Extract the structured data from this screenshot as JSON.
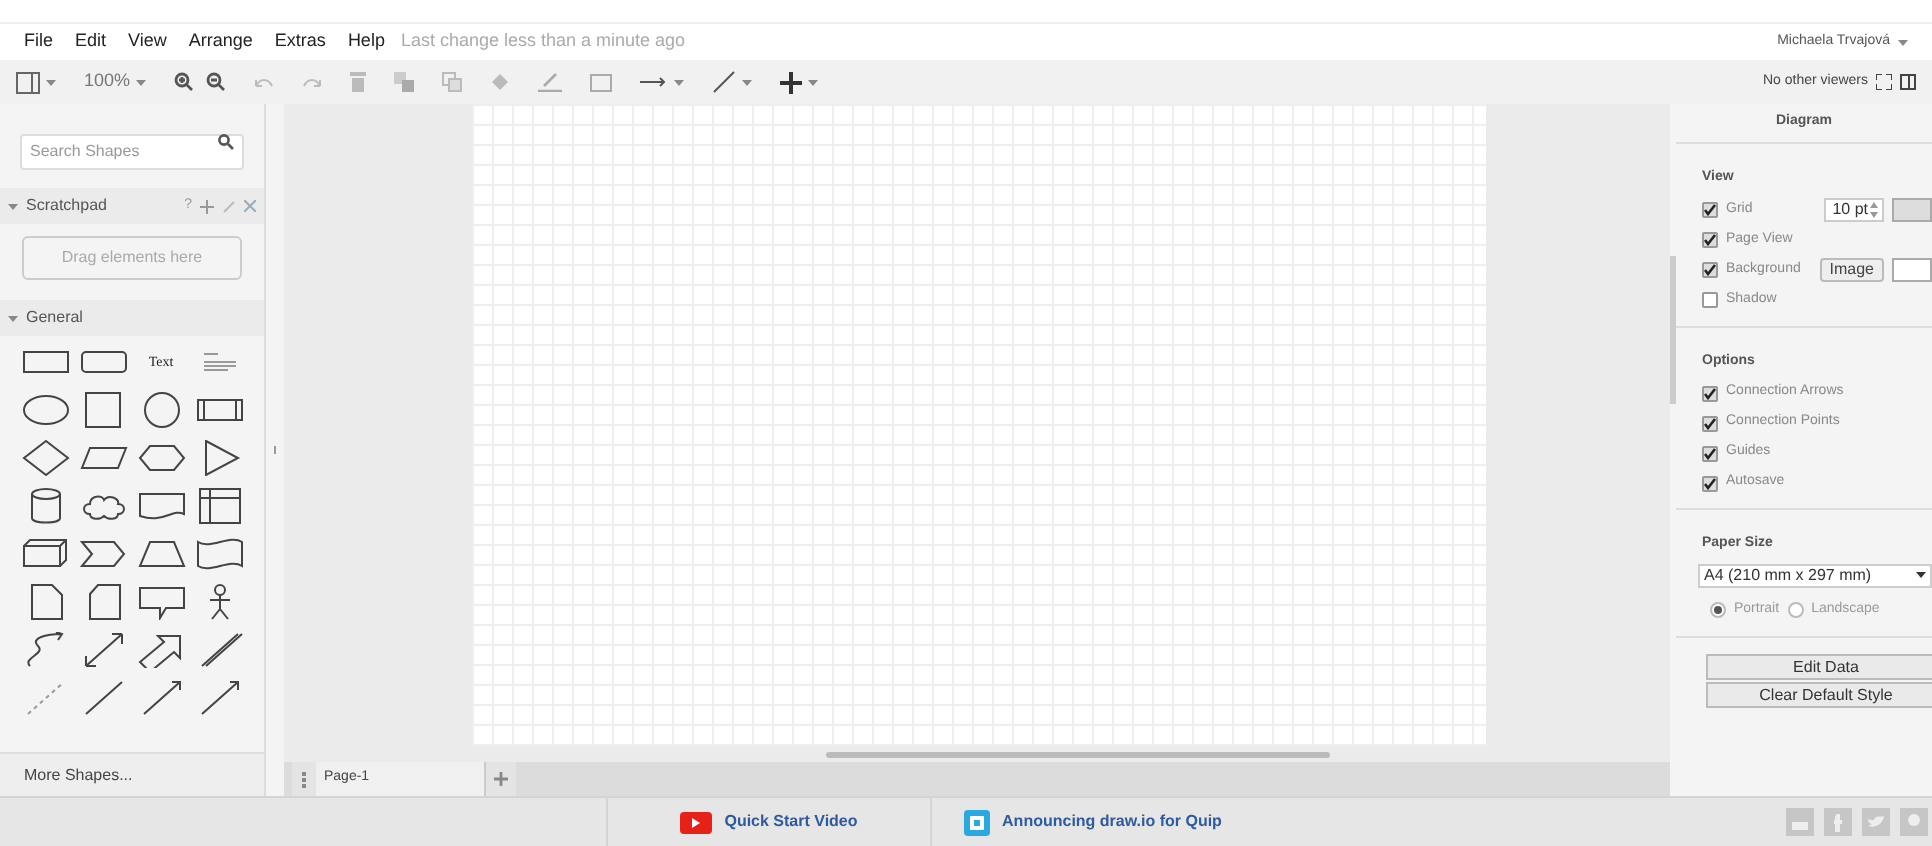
{
  "menu": [
    "File",
    "Edit",
    "View",
    "Arrange",
    "Extras",
    "Help"
  ],
  "last_change": "Last change less than a minute ago",
  "user": "Michaela Trvajová",
  "toolbar": {
    "zoom": "100%",
    "viewers": "No other viewers"
  },
  "sidebar": {
    "search": {
      "placeholder": "Search Shapes"
    },
    "scratchpad": {
      "title": "Scratchpad",
      "help": "?",
      "expanded": true,
      "hint": "Drag elements here"
    },
    "general": {
      "title": "General",
      "expanded": true,
      "text_shape": "Text"
    },
    "more_shapes": "More Shapes..."
  },
  "pages": [
    {
      "label": "Page-1",
      "selected": true
    }
  ],
  "panel": {
    "title": "Diagram",
    "view": {
      "title": "View",
      "items": [
        {
          "kind": "grid",
          "label": "Grid",
          "checked": true,
          "value": "10 pt"
        },
        {
          "kind": "plain",
          "label": "Page View",
          "checked": true
        },
        {
          "kind": "background",
          "label": "Background",
          "checked": true,
          "button": "Image"
        },
        {
          "kind": "plain",
          "label": "Shadow",
          "checked": false
        }
      ]
    },
    "options": {
      "title": "Options",
      "items": [
        {
          "label": "Connection Arrows",
          "checked": true
        },
        {
          "label": "Connection Points",
          "checked": true
        },
        {
          "label": "Guides",
          "checked": true
        },
        {
          "label": "Autosave",
          "checked": true
        }
      ]
    },
    "paper": {
      "title": "Paper Size",
      "value": "A4 (210 mm x 297 mm)",
      "orientations": [
        {
          "label": "Portrait",
          "selected": true
        },
        {
          "label": "Landscape",
          "selected": false
        }
      ]
    },
    "buttons": [
      "Edit Data",
      "Clear Default Style"
    ]
  },
  "footer": {
    "links": [
      {
        "kind": "video",
        "label": "Quick Start Video"
      },
      {
        "kind": "quip",
        "label": "Announcing draw.io for Quip"
      }
    ]
  }
}
